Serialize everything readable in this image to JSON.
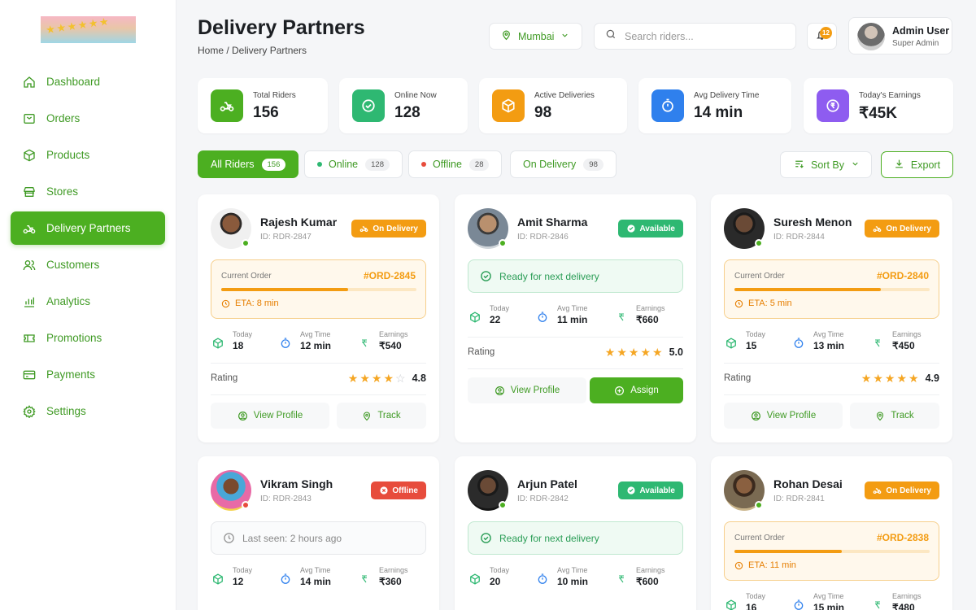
{
  "sidebar": {
    "items": [
      {
        "label": "Dashboard",
        "icon": "home-icon"
      },
      {
        "label": "Orders",
        "icon": "orders-icon"
      },
      {
        "label": "Products",
        "icon": "box-icon"
      },
      {
        "label": "Stores",
        "icon": "store-icon"
      },
      {
        "label": "Delivery Partners",
        "icon": "bike-icon",
        "active": true
      },
      {
        "label": "Customers",
        "icon": "users-icon"
      },
      {
        "label": "Analytics",
        "icon": "chart-icon"
      },
      {
        "label": "Promotions",
        "icon": "ticket-icon"
      },
      {
        "label": "Payments",
        "icon": "card-icon"
      },
      {
        "label": "Settings",
        "icon": "gear-icon"
      }
    ]
  },
  "header": {
    "title": "Delivery Partners",
    "breadcrumb": "Home / Delivery Partners",
    "location": "Mumbai",
    "search_placeholder": "Search riders...",
    "notification_count": "12",
    "user_name": "Admin User",
    "user_role": "Super Admin"
  },
  "stats": [
    {
      "label": "Total Riders",
      "value": "156",
      "color": "#4caf21",
      "icon": "bike-icon"
    },
    {
      "label": "Online Now",
      "value": "128",
      "color": "#2eb872",
      "icon": "check-circle-icon"
    },
    {
      "label": "Active Deliveries",
      "value": "98",
      "color": "#f39c12",
      "icon": "package-icon"
    },
    {
      "label": "Avg Delivery Time",
      "value": "14 min",
      "color": "#2f80ed",
      "icon": "stopwatch-icon"
    },
    {
      "label": "Today's Earnings",
      "value": "₹45K",
      "color": "#8e5cf0",
      "icon": "rupee-icon"
    }
  ],
  "filters": [
    {
      "label": "All Riders",
      "count": "156"
    },
    {
      "label": "Online",
      "count": "128"
    },
    {
      "label": "Offline",
      "count": "28"
    },
    {
      "label": "On Delivery",
      "count": "98"
    }
  ],
  "toolbar": {
    "sort_label": "Sort By",
    "export_label": "Export"
  },
  "labels": {
    "current_order": "Current Order",
    "ready": "Ready for next delivery",
    "today": "Today",
    "avg_time": "Avg Time",
    "earnings": "Earnings",
    "rating": "Rating",
    "view_profile": "View Profile",
    "track": "Track",
    "assign": "Assign"
  },
  "riders": [
    {
      "name": "Rajesh Kumar",
      "id": "ID: RDR-2847",
      "status": "On Delivery",
      "order_id": "#ORD-2845",
      "eta": "ETA: 8 min",
      "progress": 0.65,
      "today": "18",
      "avg_time": "12 min",
      "earnings": "₹540",
      "rating": "4.8",
      "stars": 4
    },
    {
      "name": "Amit Sharma",
      "id": "ID: RDR-2846",
      "status": "Available",
      "today": "22",
      "avg_time": "11 min",
      "earnings": "₹660",
      "rating": "5.0",
      "stars": 5
    },
    {
      "name": "Suresh Menon",
      "id": "ID: RDR-2844",
      "status": "On Delivery",
      "order_id": "#ORD-2840",
      "eta": "ETA: 5 min",
      "progress": 0.75,
      "today": "15",
      "avg_time": "13 min",
      "earnings": "₹450",
      "rating": "4.9",
      "stars": 5
    },
    {
      "name": "Vikram Singh",
      "id": "ID: RDR-2843",
      "status": "Offline",
      "last_seen": "Last seen: 2 hours ago",
      "today": "12",
      "avg_time": "14 min",
      "earnings": "₹360"
    },
    {
      "name": "Arjun Patel",
      "id": "ID: RDR-2842",
      "status": "Available",
      "today": "20",
      "avg_time": "10 min",
      "earnings": "₹600"
    },
    {
      "name": "Rohan Desai",
      "id": "ID: RDR-2841",
      "status": "On Delivery",
      "order_id": "#ORD-2838",
      "eta": "ETA: 11 min",
      "progress": 0.55,
      "today": "16",
      "avg_time": "15 min",
      "earnings": "₹480"
    }
  ]
}
